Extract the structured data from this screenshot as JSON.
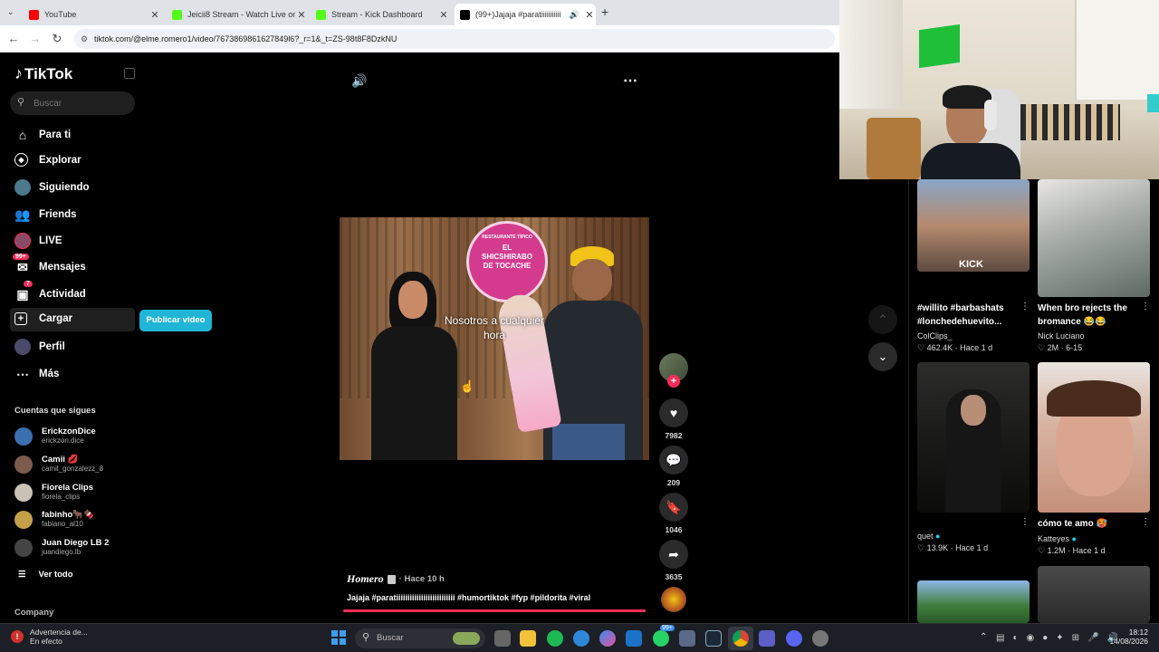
{
  "browser": {
    "tabs": [
      {
        "title": "YouTube",
        "color": "#ff0000"
      },
      {
        "title": "Jeicii8 Stream - Watch Live on K",
        "color": "#53fc18"
      },
      {
        "title": "Stream - Kick Dashboard",
        "color": "#53fc18"
      },
      {
        "title": "(99+)Jajaja #paratiiiiiiiiiii",
        "color": "#000000"
      }
    ],
    "new_tab": "+",
    "url": "tiktok.com/@elme.romero1/video/7673869861627849l6?_r=1&_t=ZS-98t8F8DzkNU"
  },
  "sidebar": {
    "logo": "TikTok",
    "search_placeholder": "Buscar",
    "nav": [
      {
        "label": "Para ti",
        "icon": "home-icon"
      },
      {
        "label": "Explorar",
        "icon": "compass-icon"
      },
      {
        "label": "Siguiendo",
        "icon": "following-icon"
      },
      {
        "label": "Friends",
        "icon": "friends-icon"
      },
      {
        "label": "LIVE",
        "icon": "live-icon"
      },
      {
        "label": "Mensajes",
        "icon": "message-icon",
        "badge": "99+"
      },
      {
        "label": "Actividad",
        "icon": "activity-icon",
        "badge": "7"
      },
      {
        "label": "Cargar",
        "icon": "upload-icon"
      },
      {
        "label": "Perfil",
        "icon": "profile-icon"
      },
      {
        "label": "Más",
        "icon": "more-icon"
      }
    ],
    "publish_button": "Publicar video",
    "following_title": "Cuentas que sigues",
    "following": [
      {
        "name": "ErickzonDice",
        "handle": "erickzon.dice"
      },
      {
        "name": "Camii 💋",
        "handle": "camil_gonzalezz_8"
      },
      {
        "name": "Fiorela Clips",
        "handle": "fiorela_clips"
      },
      {
        "name": "fabinho🐂🍫",
        "handle": "fabiano_al10"
      },
      {
        "name": "Juan Diego LB 2",
        "handle": "juandiego.lb"
      }
    ],
    "see_all": "Ver todo",
    "company": "Company"
  },
  "video": {
    "overlay_text": "Nosotros a cualquier hora",
    "sign_top": "RESTAURANTE TÍPICO",
    "sign_main": "EL SHICSHIRABO DE TOCACHE",
    "author": "Homero",
    "time": "· Hace 10 h",
    "caption": "Jajaja #paratiiiiiiiiiiiiiiiiiiiiiiiiii #humortiktok #fyp #pildorita #viral",
    "likes": "7982",
    "comments": "209",
    "saves": "1046",
    "shares": "3635"
  },
  "feed": [
    {
      "title": "#willito #barbashats #lonchedehuevito...",
      "user": "ColClips_",
      "likes": "462.4K",
      "time": "Hace 1 d"
    },
    {
      "title": "When bro rejects the bromance 😂😂",
      "user": "Nick Luciano",
      "likes": "2M",
      "time": "6-15"
    },
    {
      "title": "",
      "user": "quet",
      "likes": "13.9K",
      "time": "Hace 1 d"
    },
    {
      "title": "cómo te amo 🥵",
      "user": "Katteyes",
      "likes": "1.2M",
      "time": "Hace 1 d"
    }
  ],
  "feed_badge": "KICK",
  "taskbar": {
    "notify_title": "Advertencia de...",
    "notify_sub": "En efecto",
    "search_placeholder": "Buscar",
    "clock_time": "18:12",
    "clock_date": "14/08/2026",
    "discord_badge": "99+"
  }
}
